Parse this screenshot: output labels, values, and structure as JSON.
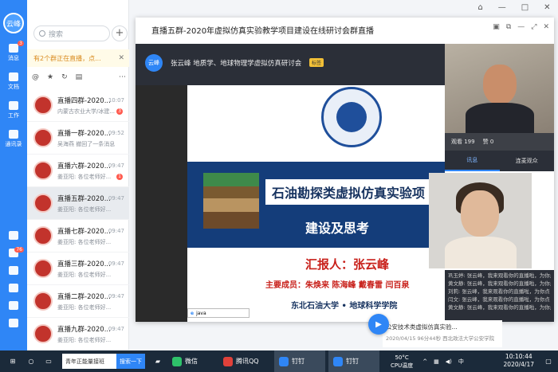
{
  "rail": {
    "avatar": "云峰",
    "items": [
      {
        "label": "消息",
        "badge": "3"
      },
      {
        "label": "文档",
        "badge": ""
      },
      {
        "label": "工作",
        "badge": ""
      },
      {
        "label": "通讯录",
        "badge": ""
      }
    ],
    "lower_badge": "76"
  },
  "list": {
    "search_placeholder": "搜索",
    "notice": "有2个群正在直播，点...",
    "chats": [
      {
        "name": "直播四群-2020...",
        "preview": "内蒙古农业大学/冰建...",
        "time": "10:07",
        "badge": "3"
      },
      {
        "name": "直播一群-2020...",
        "preview": "吴海燕 撤回了一条消息",
        "time": "09:52",
        "badge": ""
      },
      {
        "name": "直播六群-2020...",
        "preview": "姜亚阳: 各位老师好...",
        "time": "09:47",
        "badge": "1"
      },
      {
        "name": "直播五群-2020...",
        "preview": "姜亚阳: 各位老师好...",
        "time": "09:47",
        "badge": ""
      },
      {
        "name": "直播七群-2020...",
        "preview": "姜亚阳: 各位老师好...",
        "time": "09:47",
        "badge": ""
      },
      {
        "name": "直播三群-2020...",
        "preview": "姜亚阳: 各位老师好...",
        "time": "09:47",
        "badge": ""
      },
      {
        "name": "直播二群-2020...",
        "preview": "姜亚阳: 各位老师好...",
        "time": "09:47",
        "badge": ""
      },
      {
        "name": "直播九群-2020...",
        "preview": "姜亚阳: 各位老师好...",
        "time": "09:47",
        "badge": ""
      }
    ]
  },
  "live": {
    "title": "直播五群-2020年虚拟仿真实验教学项目建设在线研讨会群直播",
    "logo": "云峰",
    "presenter": "张云峰  地质学、地球物理学虚拟仿真研讨会",
    "tag": "标签",
    "slide": {
      "title_line1": "石油勘探类虚拟仿真实验项",
      "title_line2": "建设及思考",
      "reporter": "汇报人：张云峰",
      "members": "主要成员：朱焕来  陈海峰  戴春雷  闫百泉",
      "university": "东北石油大学 • 地球科学学院",
      "bar_text": "java"
    },
    "viewers": "观看 199",
    "likes": "赞 0",
    "tab_active": "讯息",
    "tab_other": "连麦观众",
    "messages": [
      "巩玉婷: 张云峰，我来观看你的直播啦，为你点",
      "黄文静: 张云峰，我来观看你的直播啦，为你点",
      "刘莉: 张云峰，我来观看你的直播啦，为你点",
      "闫文: 张云峰，我来观看你的直播啦，为你点",
      "黄文静: 张云峰，我来观看你的直播啦，为你点"
    ],
    "below_title": "公安技术类虚拟仿真实验...",
    "below_sub": "2020/04/15 96分44秒 西北政法大学公安学院"
  },
  "taskbar": {
    "search_text": "青年正能量接班",
    "search_btn": "搜索一下",
    "apps": [
      "微信",
      "腾讯QQ",
      "钉钉",
      "钉钉"
    ],
    "temp": "50°C",
    "temp_label": "CPU温度",
    "ime": "中",
    "time": "10:10:44",
    "date": "2020/4/17"
  }
}
